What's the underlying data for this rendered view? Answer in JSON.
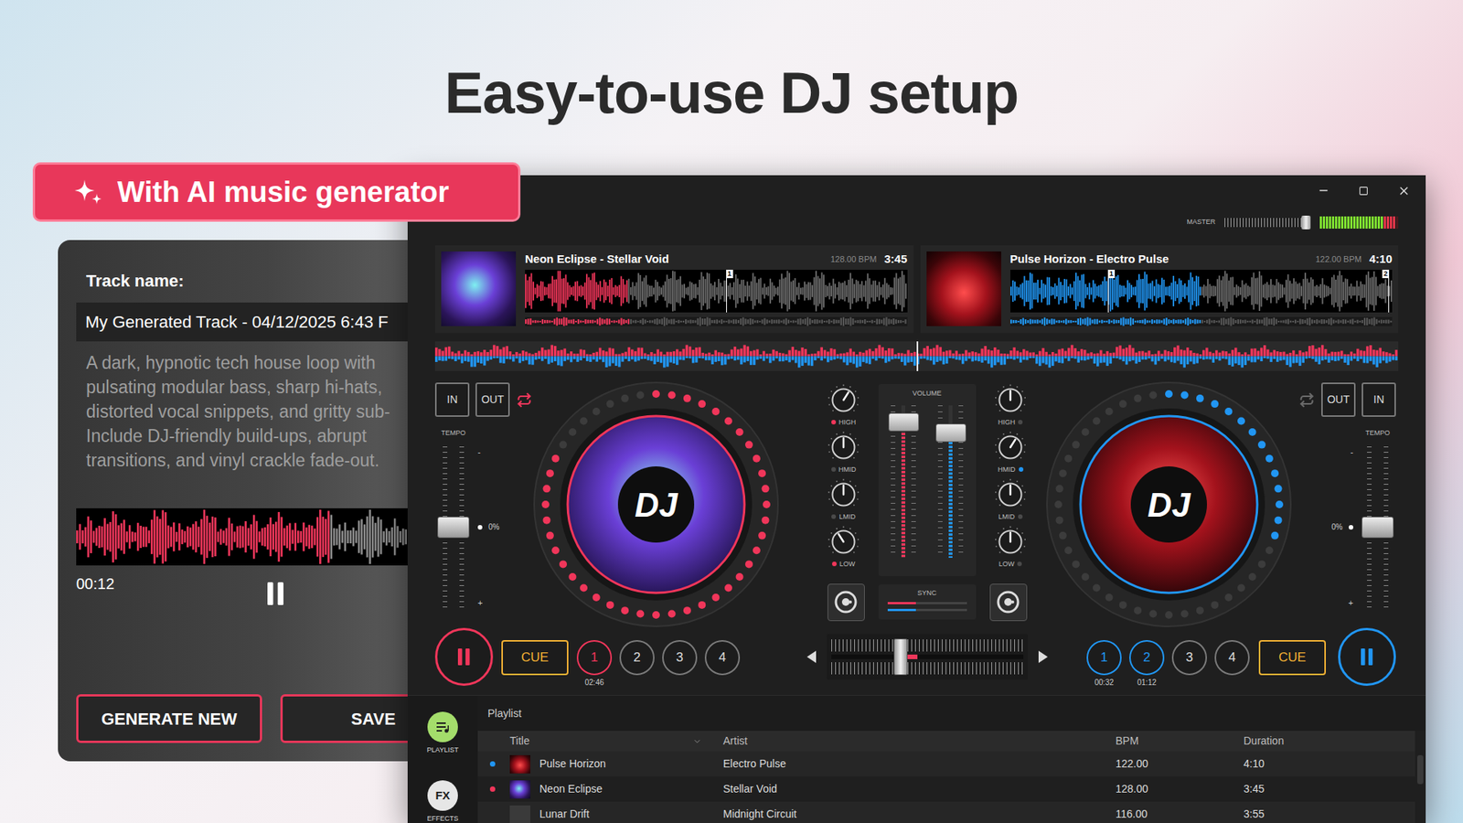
{
  "page": {
    "title": "Easy-to-use DJ setup",
    "badge": "With AI music generator"
  },
  "generator": {
    "label": "Track name:",
    "track_name": "My Generated Track - 04/12/2025 6:43 F",
    "prompt_lines": [
      "A dark, hypnotic tech house loop with",
      "pulsating modular bass, sharp hi-hats,",
      "distorted vocal snippets, and gritty sub-",
      "Include DJ-friendly build-ups, abrupt",
      "transitions, and vinyl crackle fade-out."
    ],
    "progress": 0.76,
    "time": "00:12",
    "playing": true,
    "buttons": [
      {
        "label": "GENERATE NEW"
      },
      {
        "label": "SAVE"
      }
    ]
  },
  "master": {
    "label": "MASTER",
    "level": 0.92,
    "meter_level": 0.93
  },
  "overview": {
    "playhead": 0.5
  },
  "decks": [
    {
      "side": "left",
      "title": "Neon Eclipse - Stellar Void",
      "bpm": "128.00 BPM",
      "time": "3:45",
      "color": "#f0365a",
      "progress": 0.27,
      "markers": [
        {
          "label": "1",
          "at": 0.526
        }
      ],
      "in_label": "IN",
      "out_label": "OUT",
      "loop_on": true,
      "tempo_label": "TEMPO",
      "tempo_level": 0.5,
      "tempo_reading": "0%",
      "tempo_top": "-",
      "tempo_bottom": "+",
      "ring_level": 0.82,
      "logo": "DJ",
      "playing": true,
      "cue_label": "CUE",
      "hot_cues": [
        {
          "label": "1",
          "selected": true,
          "time": "02:46"
        },
        {
          "label": "2",
          "selected": false
        },
        {
          "label": "3",
          "selected": false
        },
        {
          "label": "4",
          "selected": false
        }
      ],
      "eq": [
        {
          "label": "HIGH",
          "level": 0.62,
          "on": true
        },
        {
          "label": "HMID",
          "level": 0.5,
          "on": false
        },
        {
          "label": "LMID",
          "level": 0.5,
          "on": false
        },
        {
          "label": "LOW",
          "level": 0.38,
          "on": true
        }
      ],
      "volume": 0.95,
      "meter": 0.92,
      "sync_level": 0.36
    },
    {
      "side": "right",
      "title": "Pulse Horizon - Electro Pulse",
      "bpm": "122.00 BPM",
      "time": "4:10",
      "color": "#2196f3",
      "progress": 0.5,
      "markers": [
        {
          "label": "1",
          "at": 0.256
        },
        {
          "label": "2",
          "at": 0.99
        }
      ],
      "in_label": "IN",
      "out_label": "OUT",
      "loop_on": false,
      "tempo_label": "TEMPO",
      "tempo_level": 0.5,
      "tempo_reading": "0%",
      "tempo_top": "-",
      "tempo_bottom": "+",
      "ring_level": 0.3,
      "logo": "DJ",
      "playing": true,
      "cue_label": "CUE",
      "hot_cues": [
        {
          "label": "1",
          "selected": true,
          "time": "00:32"
        },
        {
          "label": "2",
          "selected": true,
          "time": "01:12"
        },
        {
          "label": "3",
          "selected": false
        },
        {
          "label": "4",
          "selected": false
        }
      ],
      "eq": [
        {
          "label": "HIGH",
          "level": 0.5,
          "on": false
        },
        {
          "label": "HMID",
          "level": 0.62,
          "on": true
        },
        {
          "label": "LMID",
          "level": 0.5,
          "on": false
        },
        {
          "label": "LOW",
          "level": 0.5,
          "on": false
        }
      ],
      "volume": 0.82,
      "meter": 0.86,
      "sync_level": 0.36
    }
  ],
  "mixer": {
    "volume_label": "VOLUME",
    "sync_label": "SYNC",
    "crossfader": 0.37
  },
  "playlist": {
    "sidebar": [
      {
        "kind": "playlist",
        "label": "PLAYLIST",
        "selected": true
      },
      {
        "kind": "effects",
        "badge": "FX",
        "label": "EFFECTS",
        "selected": false
      }
    ],
    "title": "Playlist",
    "columns": [
      "Title",
      "Artist",
      "BPM",
      "Duration"
    ],
    "rows": [
      {
        "title": "Pulse Horizon",
        "artist": "Electro Pulse",
        "bpm": "122.00",
        "duration": "4:10",
        "color": "#2196f3",
        "art": "right"
      },
      {
        "title": "Neon Eclipse",
        "artist": "Stellar Void",
        "bpm": "128.00",
        "duration": "3:45",
        "color": "#f0365a",
        "art": "left"
      },
      {
        "title": "Lunar Drift",
        "artist": "Midnight Circuit",
        "bpm": "116.00",
        "duration": "3:55",
        "art": "none"
      }
    ]
  }
}
